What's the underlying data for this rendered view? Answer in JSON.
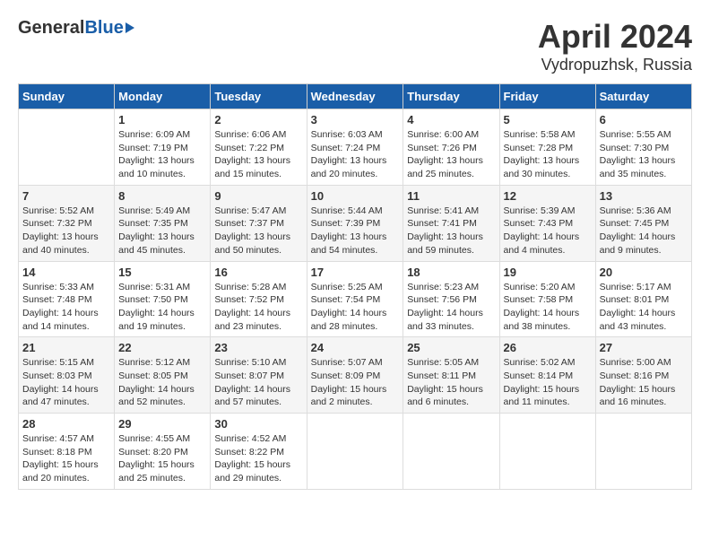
{
  "header": {
    "logo_general": "General",
    "logo_blue": "Blue",
    "month": "April 2024",
    "location": "Vydropuzhsk, Russia"
  },
  "weekdays": [
    "Sunday",
    "Monday",
    "Tuesday",
    "Wednesday",
    "Thursday",
    "Friday",
    "Saturday"
  ],
  "weeks": [
    [
      {
        "day": "",
        "sunrise": "",
        "sunset": "",
        "daylight": ""
      },
      {
        "day": "1",
        "sunrise": "Sunrise: 6:09 AM",
        "sunset": "Sunset: 7:19 PM",
        "daylight": "Daylight: 13 hours and 10 minutes."
      },
      {
        "day": "2",
        "sunrise": "Sunrise: 6:06 AM",
        "sunset": "Sunset: 7:22 PM",
        "daylight": "Daylight: 13 hours and 15 minutes."
      },
      {
        "day": "3",
        "sunrise": "Sunrise: 6:03 AM",
        "sunset": "Sunset: 7:24 PM",
        "daylight": "Daylight: 13 hours and 20 minutes."
      },
      {
        "day": "4",
        "sunrise": "Sunrise: 6:00 AM",
        "sunset": "Sunset: 7:26 PM",
        "daylight": "Daylight: 13 hours and 25 minutes."
      },
      {
        "day": "5",
        "sunrise": "Sunrise: 5:58 AM",
        "sunset": "Sunset: 7:28 PM",
        "daylight": "Daylight: 13 hours and 30 minutes."
      },
      {
        "day": "6",
        "sunrise": "Sunrise: 5:55 AM",
        "sunset": "Sunset: 7:30 PM",
        "daylight": "Daylight: 13 hours and 35 minutes."
      }
    ],
    [
      {
        "day": "7",
        "sunrise": "Sunrise: 5:52 AM",
        "sunset": "Sunset: 7:32 PM",
        "daylight": "Daylight: 13 hours and 40 minutes."
      },
      {
        "day": "8",
        "sunrise": "Sunrise: 5:49 AM",
        "sunset": "Sunset: 7:35 PM",
        "daylight": "Daylight: 13 hours and 45 minutes."
      },
      {
        "day": "9",
        "sunrise": "Sunrise: 5:47 AM",
        "sunset": "Sunset: 7:37 PM",
        "daylight": "Daylight: 13 hours and 50 minutes."
      },
      {
        "day": "10",
        "sunrise": "Sunrise: 5:44 AM",
        "sunset": "Sunset: 7:39 PM",
        "daylight": "Daylight: 13 hours and 54 minutes."
      },
      {
        "day": "11",
        "sunrise": "Sunrise: 5:41 AM",
        "sunset": "Sunset: 7:41 PM",
        "daylight": "Daylight: 13 hours and 59 minutes."
      },
      {
        "day": "12",
        "sunrise": "Sunrise: 5:39 AM",
        "sunset": "Sunset: 7:43 PM",
        "daylight": "Daylight: 14 hours and 4 minutes."
      },
      {
        "day": "13",
        "sunrise": "Sunrise: 5:36 AM",
        "sunset": "Sunset: 7:45 PM",
        "daylight": "Daylight: 14 hours and 9 minutes."
      }
    ],
    [
      {
        "day": "14",
        "sunrise": "Sunrise: 5:33 AM",
        "sunset": "Sunset: 7:48 PM",
        "daylight": "Daylight: 14 hours and 14 minutes."
      },
      {
        "day": "15",
        "sunrise": "Sunrise: 5:31 AM",
        "sunset": "Sunset: 7:50 PM",
        "daylight": "Daylight: 14 hours and 19 minutes."
      },
      {
        "day": "16",
        "sunrise": "Sunrise: 5:28 AM",
        "sunset": "Sunset: 7:52 PM",
        "daylight": "Daylight: 14 hours and 23 minutes."
      },
      {
        "day": "17",
        "sunrise": "Sunrise: 5:25 AM",
        "sunset": "Sunset: 7:54 PM",
        "daylight": "Daylight: 14 hours and 28 minutes."
      },
      {
        "day": "18",
        "sunrise": "Sunrise: 5:23 AM",
        "sunset": "Sunset: 7:56 PM",
        "daylight": "Daylight: 14 hours and 33 minutes."
      },
      {
        "day": "19",
        "sunrise": "Sunrise: 5:20 AM",
        "sunset": "Sunset: 7:58 PM",
        "daylight": "Daylight: 14 hours and 38 minutes."
      },
      {
        "day": "20",
        "sunrise": "Sunrise: 5:17 AM",
        "sunset": "Sunset: 8:01 PM",
        "daylight": "Daylight: 14 hours and 43 minutes."
      }
    ],
    [
      {
        "day": "21",
        "sunrise": "Sunrise: 5:15 AM",
        "sunset": "Sunset: 8:03 PM",
        "daylight": "Daylight: 14 hours and 47 minutes."
      },
      {
        "day": "22",
        "sunrise": "Sunrise: 5:12 AM",
        "sunset": "Sunset: 8:05 PM",
        "daylight": "Daylight: 14 hours and 52 minutes."
      },
      {
        "day": "23",
        "sunrise": "Sunrise: 5:10 AM",
        "sunset": "Sunset: 8:07 PM",
        "daylight": "Daylight: 14 hours and 57 minutes."
      },
      {
        "day": "24",
        "sunrise": "Sunrise: 5:07 AM",
        "sunset": "Sunset: 8:09 PM",
        "daylight": "Daylight: 15 hours and 2 minutes."
      },
      {
        "day": "25",
        "sunrise": "Sunrise: 5:05 AM",
        "sunset": "Sunset: 8:11 PM",
        "daylight": "Daylight: 15 hours and 6 minutes."
      },
      {
        "day": "26",
        "sunrise": "Sunrise: 5:02 AM",
        "sunset": "Sunset: 8:14 PM",
        "daylight": "Daylight: 15 hours and 11 minutes."
      },
      {
        "day": "27",
        "sunrise": "Sunrise: 5:00 AM",
        "sunset": "Sunset: 8:16 PM",
        "daylight": "Daylight: 15 hours and 16 minutes."
      }
    ],
    [
      {
        "day": "28",
        "sunrise": "Sunrise: 4:57 AM",
        "sunset": "Sunset: 8:18 PM",
        "daylight": "Daylight: 15 hours and 20 minutes."
      },
      {
        "day": "29",
        "sunrise": "Sunrise: 4:55 AM",
        "sunset": "Sunset: 8:20 PM",
        "daylight": "Daylight: 15 hours and 25 minutes."
      },
      {
        "day": "30",
        "sunrise": "Sunrise: 4:52 AM",
        "sunset": "Sunset: 8:22 PM",
        "daylight": "Daylight: 15 hours and 29 minutes."
      },
      {
        "day": "",
        "sunrise": "",
        "sunset": "",
        "daylight": ""
      },
      {
        "day": "",
        "sunrise": "",
        "sunset": "",
        "daylight": ""
      },
      {
        "day": "",
        "sunrise": "",
        "sunset": "",
        "daylight": ""
      },
      {
        "day": "",
        "sunrise": "",
        "sunset": "",
        "daylight": ""
      }
    ]
  ]
}
